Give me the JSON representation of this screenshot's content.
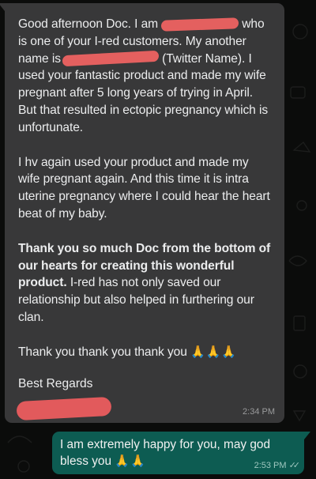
{
  "received_message": {
    "greeting": "Good afternoon Doc. I am",
    "intro_mid": "who is one of your I-red customers. My another name is",
    "intro_rest": "(Twitter Name). I used your fantastic product and made my wife pregnant after 5 long years of trying in April. But that resulted in ectopic pregnancy which is unfortunate.",
    "paragraph_2": "I hv again used your product and made my wife pregnant again. And this time it is intra uterine pregnancy where I could hear the heart beat of my baby.",
    "paragraph_3_bold": "Thank you so much Doc from the bottom of our hearts for creating this wonderful product.",
    "paragraph_3_rest": "I-red has not only saved our relationship but also helped in furthering our clan.",
    "thanks_line": "Thank you thank you thank you",
    "thanks_emoji": "🙏🙏🙏",
    "signoff": "Best Regards",
    "time": "2:34 PM"
  },
  "sent_message": {
    "text": "I am extremely happy for you, may god bless you",
    "emoji": "🙏🙏",
    "time": "2:53 PM",
    "read_ticks": "✓✓"
  },
  "colors": {
    "background": "#0b0c0b",
    "incoming_bubble": "#383839",
    "outgoing_bubble": "#0d5c52",
    "redaction": "#e4605f"
  },
  "icons": [
    "double-check-icon",
    "folded-hands-emoji"
  ]
}
